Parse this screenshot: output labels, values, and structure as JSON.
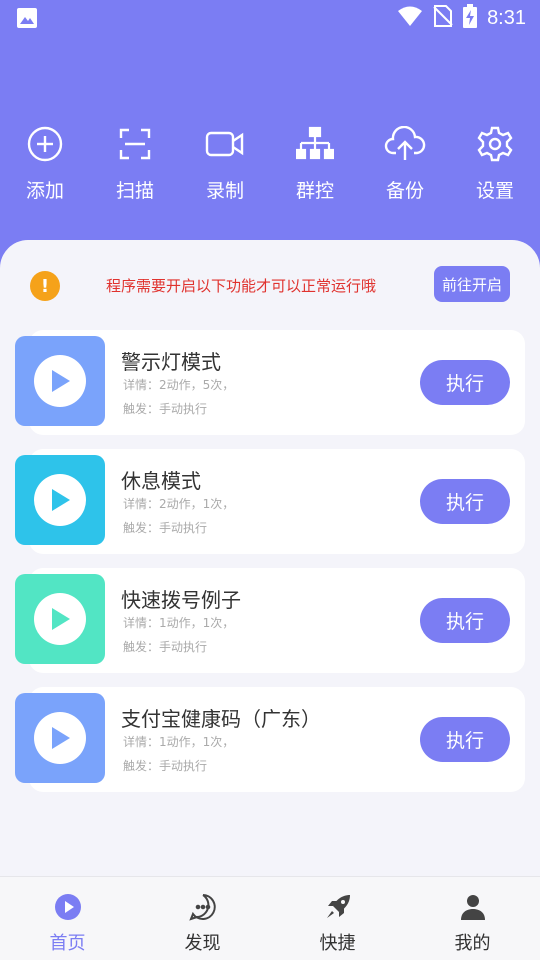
{
  "status_bar": {
    "time": "8:31"
  },
  "toolbar": {
    "items": [
      {
        "label": "添加",
        "icon": "plus-circle-icon"
      },
      {
        "label": "扫描",
        "icon": "scan-icon"
      },
      {
        "label": "录制",
        "icon": "video-camera-icon"
      },
      {
        "label": "群控",
        "icon": "network-icon"
      },
      {
        "label": "备份",
        "icon": "cloud-upload-icon"
      },
      {
        "label": "设置",
        "icon": "gear-icon"
      }
    ]
  },
  "notice": {
    "icon": "warning-icon",
    "text": "程序需要开启以下功能才可以正常运行哦",
    "button": "前往开启"
  },
  "tasks": [
    {
      "title": "警示灯模式",
      "detail": "详情：2动作，5次，",
      "trigger": "触发：手动执行",
      "button": "执行",
      "color": "#7aa3fb"
    },
    {
      "title": "休息模式",
      "detail": "详情：2动作，1次，",
      "trigger": "触发：手动执行",
      "button": "执行",
      "color": "#2ec3ea"
    },
    {
      "title": "快速拨号例子",
      "detail": "详情：1动作，1次，",
      "trigger": "触发：手动执行",
      "button": "执行",
      "color": "#52e5c4"
    },
    {
      "title": "支付宝健康码（广东）",
      "detail": "详情：1动作，1次，",
      "trigger": "触发：手动执行",
      "button": "执行",
      "color": "#7aa3fb"
    }
  ],
  "bottom_nav": {
    "items": [
      {
        "label": "首页",
        "icon": "play-circle-icon",
        "active": true
      },
      {
        "label": "发现",
        "icon": "chat-bubble-icon",
        "active": false
      },
      {
        "label": "快捷",
        "icon": "rocket-icon",
        "active": false
      },
      {
        "label": "我的",
        "icon": "user-icon",
        "active": false
      }
    ]
  },
  "colors": {
    "primary": "#7b7df3",
    "warning": "#f5a21a",
    "notice_text": "#e0322e"
  }
}
